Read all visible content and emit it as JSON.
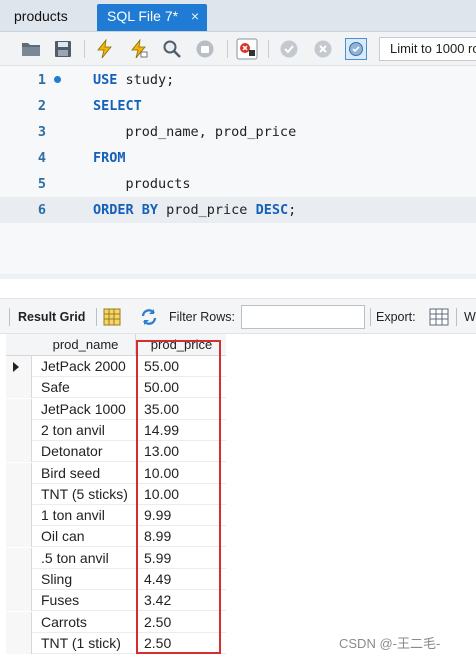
{
  "tabs": [
    {
      "label": "products",
      "active": false
    },
    {
      "label": "SQL File 7*",
      "active": true,
      "close": "×"
    }
  ],
  "toolbar": {
    "limit_label": "Limit to 1000 ro",
    "icons": [
      "open-folder-icon",
      "save-icon",
      "execute-lightning-icon",
      "execute-current-lightning-icon",
      "explain-magnifier-icon",
      "stop-icon",
      "toggle-error-icon",
      "commit-check-icon",
      "rollback-x-icon",
      "autocommit-icon"
    ]
  },
  "editor": {
    "lines": [
      {
        "num": "1",
        "marker": true,
        "tokens": [
          {
            "t": "USE",
            "kw": true
          },
          {
            "t": " study;",
            "kw": false
          }
        ]
      },
      {
        "num": "2",
        "marker": false,
        "tokens": [
          {
            "t": "SELECT",
            "kw": true
          }
        ]
      },
      {
        "num": "3",
        "marker": false,
        "tokens": [
          {
            "t": "    prod_name, prod_price",
            "kw": false
          }
        ]
      },
      {
        "num": "4",
        "marker": false,
        "tokens": [
          {
            "t": "FROM",
            "kw": true
          }
        ]
      },
      {
        "num": "5",
        "marker": false,
        "tokens": [
          {
            "t": "    products",
            "kw": false
          }
        ]
      },
      {
        "num": "6",
        "marker": false,
        "active": true,
        "tokens": [
          {
            "t": "ORDER BY",
            "kw": true
          },
          {
            "t": " prod_price ",
            "kw": false
          },
          {
            "t": "DESC",
            "kw": true
          },
          {
            "t": ";",
            "kw": false
          }
        ]
      }
    ]
  },
  "results_toolbar": {
    "result_grid": "Result Grid",
    "filter_rows": "Filter Rows:",
    "filter_value": "",
    "export": "Export:",
    "wrap": "W"
  },
  "grid": {
    "columns": [
      "prod_name",
      "prod_price"
    ],
    "rows": [
      [
        "JetPack 2000",
        "55.00"
      ],
      [
        "Safe",
        "50.00"
      ],
      [
        "JetPack 1000",
        "35.00"
      ],
      [
        "2 ton anvil",
        "14.99"
      ],
      [
        "Detonator",
        "13.00"
      ],
      [
        "Bird seed",
        "10.00"
      ],
      [
        "TNT (5 sticks)",
        "10.00"
      ],
      [
        "1 ton anvil",
        "9.99"
      ],
      [
        "Oil can",
        "8.99"
      ],
      [
        ".5 ton anvil",
        "5.99"
      ],
      [
        "Sling",
        "4.49"
      ],
      [
        "Fuses",
        "3.42"
      ],
      [
        "Carrots",
        "2.50"
      ],
      [
        "TNT (1 stick)",
        "2.50"
      ]
    ],
    "current_row": 0
  },
  "watermark": "CSDN @-王二毛-",
  "colors": {
    "accent": "#1f7bd4",
    "keyword": "#1560b8",
    "highlight_box": "#d62e2e"
  }
}
